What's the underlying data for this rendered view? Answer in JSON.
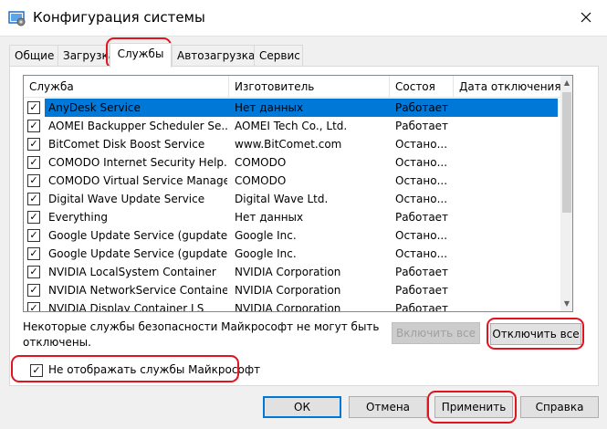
{
  "window": {
    "title": "Конфигурация системы",
    "close_glyph": "✕"
  },
  "tabs": [
    {
      "label": "Общие"
    },
    {
      "label": "Загрузка"
    },
    {
      "label": "Службы"
    },
    {
      "label": "Автозагрузка"
    },
    {
      "label": "Сервис"
    }
  ],
  "services": {
    "columns": {
      "service": "Служба",
      "manufacturer": "Изготовитель",
      "status": "Состоя",
      "disabled_date": "Дата отключения"
    },
    "rows": [
      {
        "name": "AnyDesk Service",
        "manufacturer": "Нет данных",
        "status": "Работает",
        "date": "",
        "checked": "✓"
      },
      {
        "name": "AOMEI Backupper Scheduler Se...",
        "manufacturer": "AOMEI Tech Co., Ltd.",
        "status": "Работает",
        "date": "",
        "checked": "✓"
      },
      {
        "name": "BitComet Disk Boost Service",
        "manufacturer": "www.BitComet.com",
        "status": "Остано...",
        "date": "",
        "checked": "✓"
      },
      {
        "name": "COMODO Internet Security Help...",
        "manufacturer": "COMODO",
        "status": "Остано...",
        "date": "",
        "checked": "✓"
      },
      {
        "name": "COMODO Virtual Service Manager",
        "manufacturer": "COMODO",
        "status": "Остано...",
        "date": "",
        "checked": "✓"
      },
      {
        "name": "Digital Wave Update Service",
        "manufacturer": "Digital Wave Ltd.",
        "status": "Остано...",
        "date": "",
        "checked": "✓"
      },
      {
        "name": "Everything",
        "manufacturer": "Нет данных",
        "status": "Работает",
        "date": "",
        "checked": "✓"
      },
      {
        "name": "Google Update Service (gupdate)",
        "manufacturer": "Google Inc.",
        "status": "Остано...",
        "date": "",
        "checked": "✓"
      },
      {
        "name": "Google Update Service (gupdate",
        "manufacturer": "Google Inc.",
        "status": "Остано...",
        "date": "",
        "checked": "✓"
      },
      {
        "name": "NVIDIA LocalSystem Container",
        "manufacturer": "NVIDIA Corporation",
        "status": "Работает",
        "date": "",
        "checked": "✓"
      },
      {
        "name": "NVIDIA NetworkService Container",
        "manufacturer": "NVIDIA Corporation",
        "status": "Работает",
        "date": "",
        "checked": "✓"
      },
      {
        "name": "NVIDIA Display Container LS",
        "manufacturer": "NVIDIA Corporation",
        "status": "Работает",
        "date": "",
        "checked": "✓"
      }
    ],
    "selected_index": 0
  },
  "note": {
    "line1": "Некоторые службы безопасности Майкрософт не могут быть",
    "line2": "отключены."
  },
  "buttons": {
    "enable_all": "Включить все",
    "disable_all": "Отключить все",
    "ok": "ОК",
    "cancel": "Отмена",
    "apply": "Применить",
    "help": "Справка"
  },
  "hide_ms": {
    "label": "Не отображать службы Майкрософт",
    "checked": "✓"
  },
  "scroll": {
    "up_glyph": "▲",
    "down_glyph": "▼"
  },
  "colors": {
    "accent": "#0078d7",
    "highlight_ring": "#e0141e"
  }
}
